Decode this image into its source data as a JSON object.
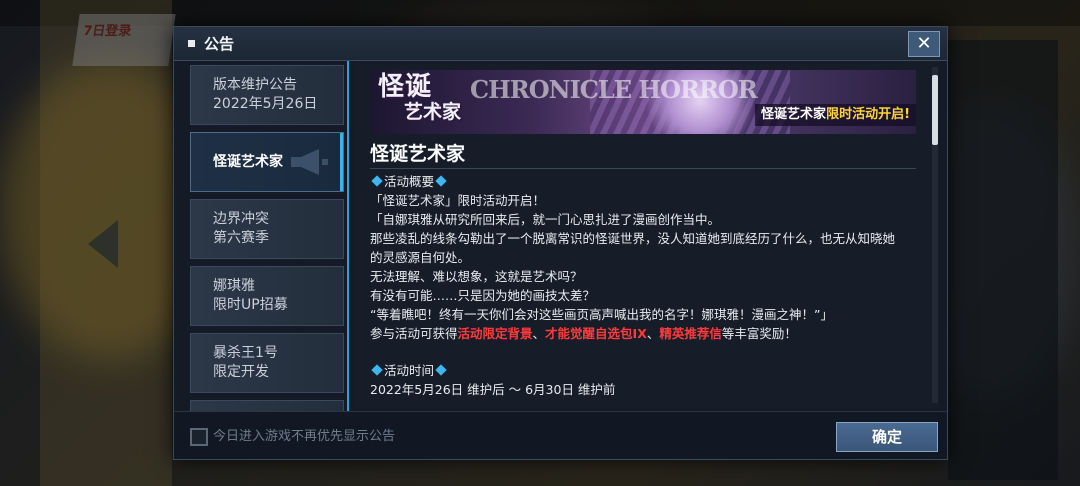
{
  "background": {
    "badge_text": "7日登录"
  },
  "dialog": {
    "title": "公告",
    "close_icon": "close-icon"
  },
  "tabs": [
    {
      "line1": "版本维护公告",
      "line2": "2022年5月26日",
      "active": false
    },
    {
      "line1": "怪诞艺术家",
      "line2": "",
      "active": true
    },
    {
      "line1": "边界冲突",
      "line2": "第六赛季",
      "active": false
    },
    {
      "line1": "娜琪雅",
      "line2": "限时UP招募",
      "active": false
    },
    {
      "line1": "暴杀王1号",
      "line2": "限定开发",
      "active": false
    }
  ],
  "banner": {
    "logo_top": "怪诞",
    "logo_bottom": "艺术家",
    "english": "CHRONICLE HORROR",
    "tag_white": "怪诞艺术家",
    "tag_yellow": "限时活动开启!"
  },
  "article": {
    "title": "怪诞艺术家",
    "section1": "活动概要",
    "p1": "「怪诞艺术家」限时活动开启！",
    "p2": "「自娜琪雅从研究所回来后，就一门心思扎进了漫画创作当中。",
    "p3": "那些凌乱的线条勾勒出了一个脱离常识的怪诞世界，没人知道她到底经历了什么，也无从知晓她",
    "p4": "的灵感源自何处。",
    "p5": "无法理解、难以想象，这就是艺术吗？",
    "p6": "有没有可能……只是因为她的画技太差？",
    "p7": "“等着瞧吧！终有一天你们会对这些画页高声喊出我的名字！娜琪雅！漫画之神！”」",
    "p8_prefix": "参与活动可获得",
    "p8_red1": "活动限定背景",
    "p8_sep1": "、",
    "p8_red2": "才能觉醒自选包IX",
    "p8_sep2": "、",
    "p8_red3": "精英推荐信",
    "p8_suffix": "等丰富奖励！",
    "section2": "活动时间",
    "time": "2022年5月26日 维护后 ～ 6月30日 维护前"
  },
  "footer": {
    "checkbox_label": "今日进入游戏不再优先显示公告",
    "checkbox_checked": false,
    "confirm_label": "确定"
  },
  "colors": {
    "accent": "#38b6e8",
    "highlight_red": "#ff3b3b",
    "highlight_yellow": "#ffd23a"
  }
}
